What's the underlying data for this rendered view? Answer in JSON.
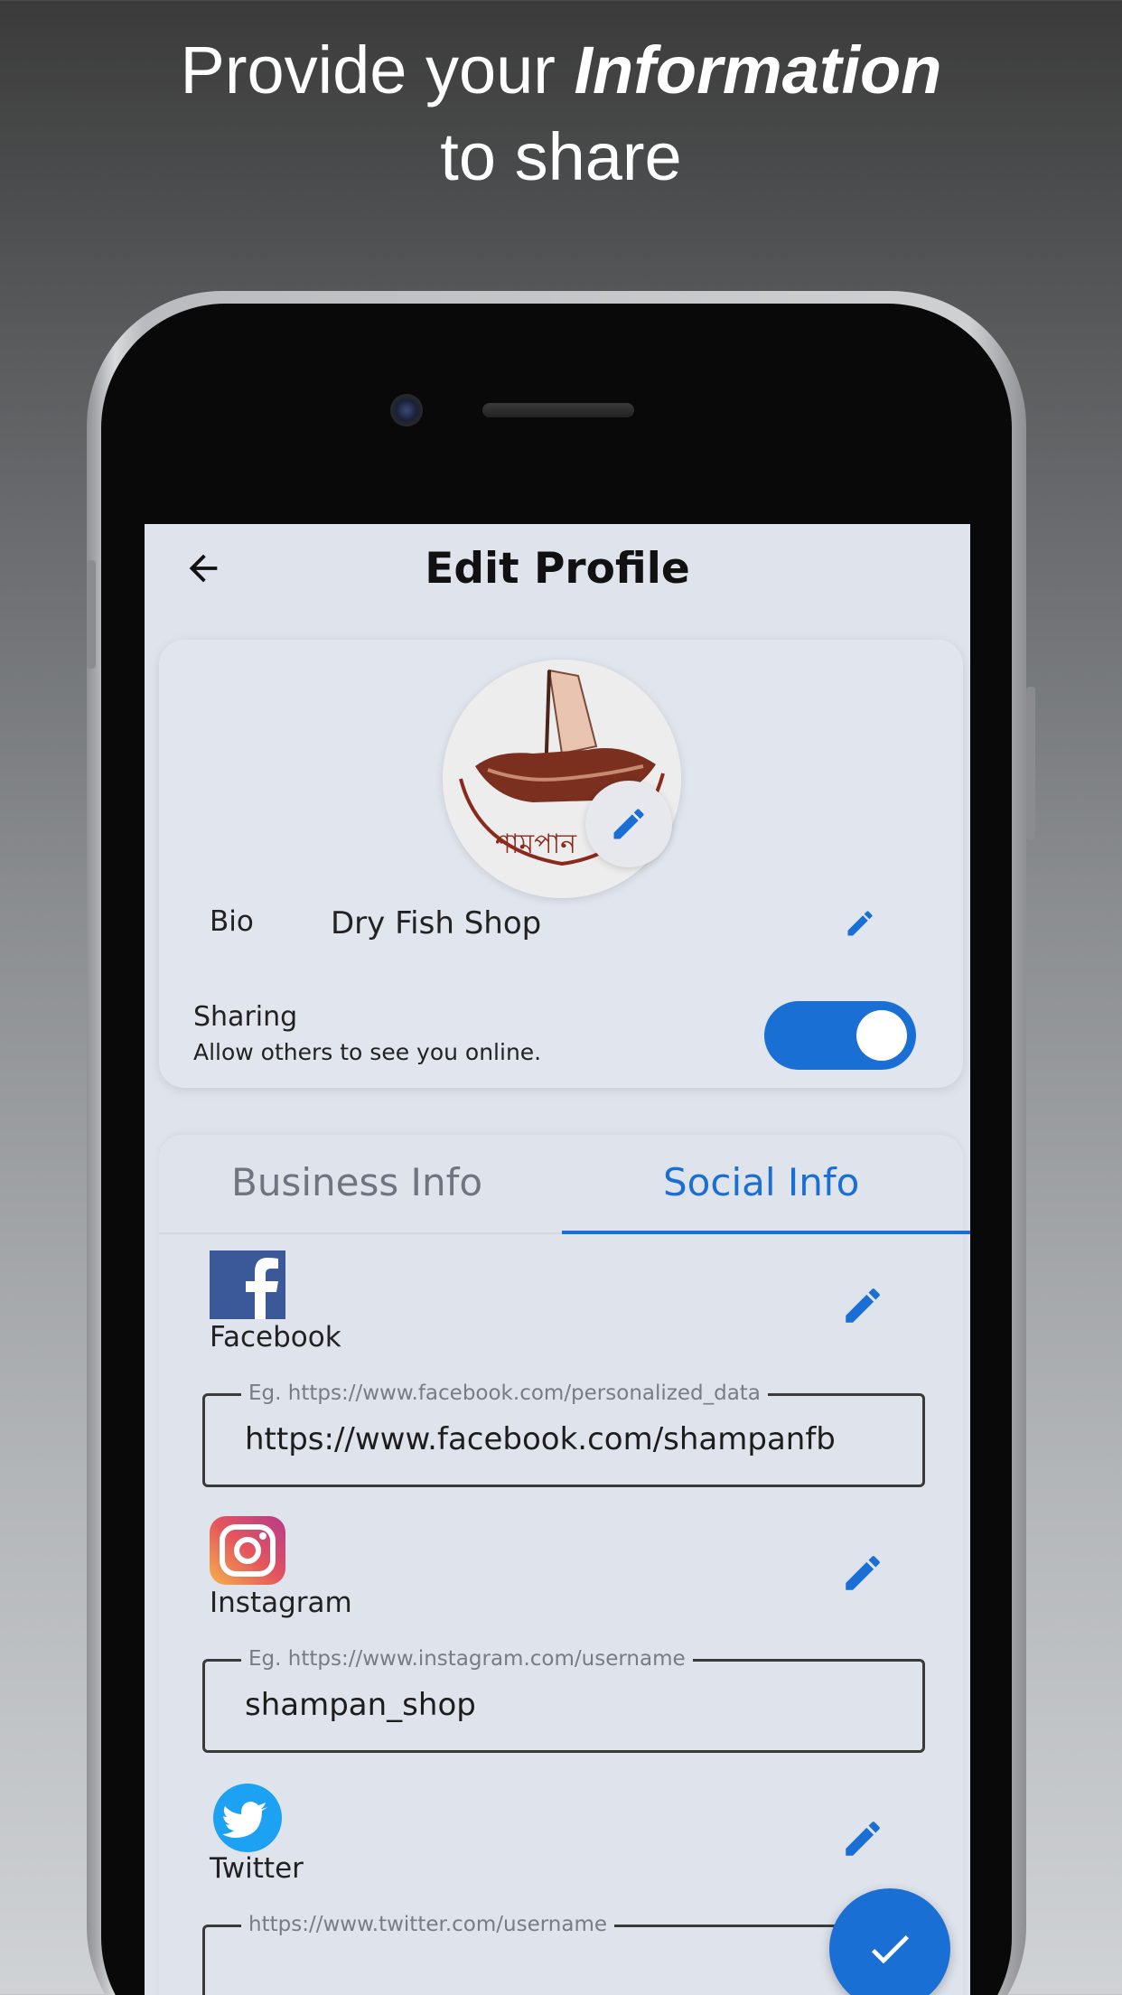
{
  "headline": {
    "line1_prefix": "Provide your ",
    "line1_emphasis": "Information",
    "line2": "to share"
  },
  "app": {
    "title": "Edit Profile",
    "back_icon": "arrow-left-icon",
    "profile": {
      "avatar_alt": "boat-logo",
      "bio_label": "Bio",
      "bio_value": "Dry Fish Shop",
      "sharing_title": "Sharing",
      "sharing_subtitle": "Allow others to see you online.",
      "sharing_enabled": true
    },
    "tabs": [
      {
        "label": "Business Info",
        "active": false
      },
      {
        "label": "Social Info",
        "active": true
      }
    ],
    "social": {
      "facebook": {
        "name": "Facebook",
        "placeholder": "Eg. https://www.facebook.com/personalized_data",
        "value": "https://www.facebook.com/shampanfb"
      },
      "instagram": {
        "name": "Instagram",
        "placeholder": "Eg. https://www.instagram.com/username",
        "value": "shampan_shop"
      },
      "twitter": {
        "name": "Twitter",
        "placeholder": "https://www.twitter.com/username",
        "value": ""
      }
    },
    "fab_icon": "check-icon",
    "colors": {
      "accent": "#1a6fd4",
      "screen_bg": "#dfe3ec",
      "facebook": "#3b5998",
      "twitter": "#1da1f2"
    }
  }
}
